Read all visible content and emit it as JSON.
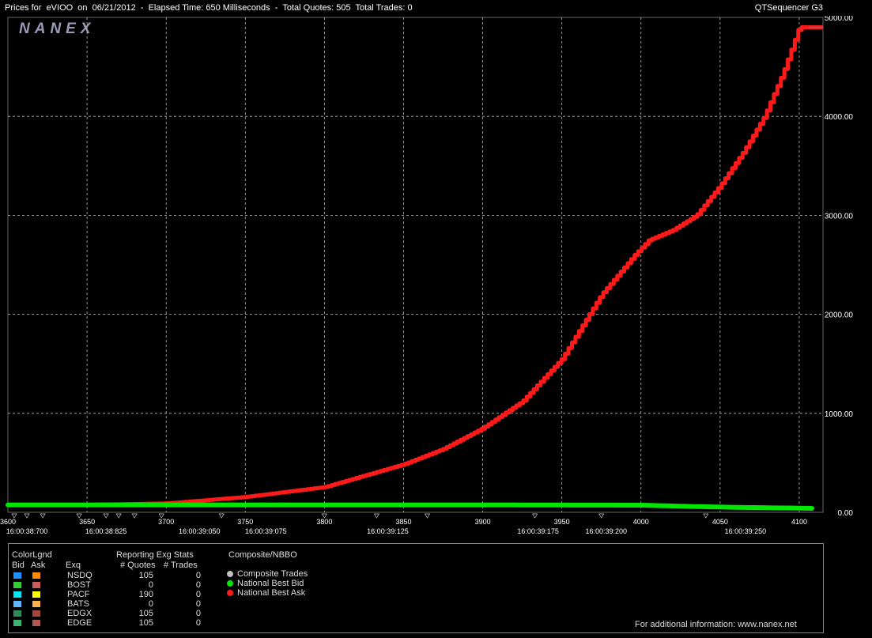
{
  "header": {
    "title": "Prices for  eVIOO  on  06/21/2012  -  Elapsed Time: 650 Milliseconds  -  Total Quotes: 505  Total Trades: 0",
    "product": "QTSequencer G3",
    "logo": "NANEX"
  },
  "colors": {
    "bid": "#00e600",
    "ask": "#ff1a1a",
    "grid": "#bbbbbb",
    "step": "#d8c060"
  },
  "chart_data": {
    "type": "line",
    "x_ticks": [
      3600,
      3650,
      3700,
      3750,
      3800,
      3850,
      3900,
      3950,
      4000,
      4050,
      4100
    ],
    "time_ticks": [
      {
        "x": 3612,
        "label": "16:00:38:700"
      },
      {
        "x": 3662,
        "label": "16:00:38:825"
      },
      {
        "x": 3721,
        "label": "16:00:39:050"
      },
      {
        "x": 3763,
        "label": "16:00:39:075"
      },
      {
        "x": 3840,
        "label": "16:00:39:125"
      },
      {
        "x": 3935,
        "label": "16:00:39:175"
      },
      {
        "x": 3978,
        "label": "16:00:39:200"
      },
      {
        "x": 4066,
        "label": "16:00:39:250"
      }
    ],
    "y_ticks": [
      "0.00",
      "1000.00",
      "2000.00",
      "3000.00",
      "4000.00",
      "5000.00"
    ],
    "xlim": [
      3600,
      4115
    ],
    "ylim": [
      0,
      5000
    ],
    "grid": true,
    "series": [
      {
        "name": "National Best Bid",
        "values": [
          [
            3600,
            75
          ],
          [
            3700,
            75
          ],
          [
            3800,
            75
          ],
          [
            3900,
            75
          ],
          [
            4000,
            72
          ],
          [
            4030,
            60
          ],
          [
            4060,
            50
          ],
          [
            4110,
            40
          ]
        ]
      },
      {
        "name": "National Best Ask",
        "values": [
          [
            3600,
            75
          ],
          [
            3650,
            75
          ],
          [
            3700,
            90
          ],
          [
            3750,
            155
          ],
          [
            3800,
            255
          ],
          [
            3850,
            485
          ],
          [
            3875,
            640
          ],
          [
            3900,
            850
          ],
          [
            3925,
            1120
          ],
          [
            3950,
            1550
          ],
          [
            3975,
            2200
          ],
          [
            3996,
            2600
          ],
          [
            4005,
            2750
          ],
          [
            4020,
            2850
          ],
          [
            4035,
            3000
          ],
          [
            4050,
            3300
          ],
          [
            4065,
            3650
          ],
          [
            4078,
            4000
          ],
          [
            4090,
            4450
          ],
          [
            4100,
            4900
          ],
          [
            4115,
            4900
          ]
        ]
      }
    ]
  },
  "legend": {
    "colorlgnd": "ColorLgnd",
    "bid_col": "Bid",
    "ask_col": "Ask",
    "exq_col": "Exq",
    "stats_title": "Reporting Exg Stats",
    "quotes_col": "# Quotes",
    "trades_col": "# Trades",
    "composite_title": "Composite/NBBO",
    "exchanges": [
      {
        "name": "NSDQ",
        "quotes": "105",
        "trades": "0",
        "bid_color": "#1e90ff",
        "ask_color": "#ff8c00"
      },
      {
        "name": "BOST",
        "quotes": "0",
        "trades": "0",
        "bid_color": "#32cd32",
        "ask_color": "#cd5c5c"
      },
      {
        "name": "PACF",
        "quotes": "190",
        "trades": "0",
        "bid_color": "#00e5ee",
        "ask_color": "#ffff00"
      },
      {
        "name": "BATS",
        "quotes": "0",
        "trades": "0",
        "bid_color": "#5fb8ff",
        "ask_color": "#ffb050"
      },
      {
        "name": "EDGX",
        "quotes": "105",
        "trades": "0",
        "bid_color": "#2e8b57",
        "ask_color": "#a0463c"
      },
      {
        "name": "EDGE",
        "quotes": "105",
        "trades": "0",
        "bid_color": "#3cb371",
        "ask_color": "#b05a50"
      }
    ],
    "composite": [
      {
        "label": "Composite Trades",
        "color": "#c0c0c0"
      },
      {
        "label": "National Best Bid",
        "color": "#00e600"
      },
      {
        "label": "National Best Ask",
        "color": "#ff1a1a"
      }
    ],
    "footer": "For additional information: www.nanex.net"
  }
}
